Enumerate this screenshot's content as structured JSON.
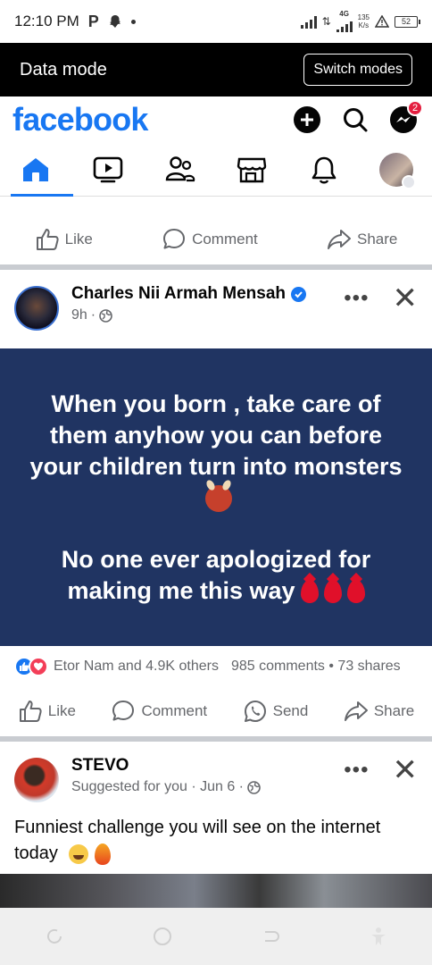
{
  "status_bar": {
    "time": "12:10 PM",
    "network_type": "4G",
    "net_speed_value": "135",
    "net_speed_unit": "K/s",
    "battery": "52"
  },
  "data_mode": {
    "title": "Data mode",
    "switch_label": "Switch modes"
  },
  "header": {
    "logo": "facebook",
    "messenger_badge": "2"
  },
  "tabs": [
    "home",
    "watch",
    "friends",
    "marketplace",
    "notifications",
    "profile-menu"
  ],
  "prev_post": {
    "like_label": "Like",
    "comment_label": "Comment",
    "share_label": "Share"
  },
  "post1": {
    "author": "Charles Nii Armah Mensah",
    "time": "9h",
    "text_line1": "When you born , take care of them anyhow you can before your children turn into monsters",
    "text_line2": "No one ever apologized for making me this way",
    "reactions_text": "Etor Nam and 4.9K others",
    "comments_shares": "985 comments • 73 shares",
    "like_label": "Like",
    "comment_label": "Comment",
    "send_label": "Send",
    "share_label": "Share",
    "bg_color": "#203462"
  },
  "post2": {
    "author": "STEVO",
    "meta": "Suggested for you · Jun 6 ·",
    "text": "Funniest challenge you will see on the internet today"
  },
  "colors": {
    "brand": "#1877f2",
    "muted": "#65676b",
    "badge": "#e41e3f"
  }
}
